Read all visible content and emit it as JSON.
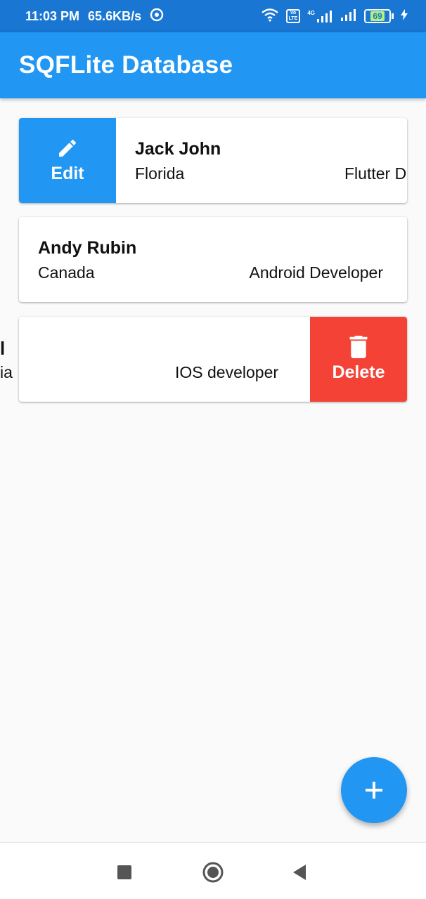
{
  "status_bar": {
    "time": "11:03 PM",
    "speed": "65.6KB/s",
    "network_label_1": "Vo",
    "network_label_2": "LTE",
    "network_type": "4G",
    "battery": "69"
  },
  "app_bar": {
    "title": "SQFLite Database"
  },
  "records": [
    {
      "name": "Jack John",
      "city": "Florida",
      "role": "Flutter Dev",
      "action_label": "Edit"
    },
    {
      "name": "Andy Rubin",
      "city": "Canada",
      "role": "Android Developer"
    },
    {
      "name_fragment": "l",
      "city_fragment": "ia",
      "role": "IOS developer",
      "action_label": "Delete"
    }
  ],
  "colors": {
    "primary": "#2196f3",
    "status_bar": "#1976d2",
    "delete": "#f44336",
    "background": "#fafafa"
  },
  "icons": {
    "edit": "pencil-icon",
    "delete": "trash-icon",
    "fab": "plus-icon",
    "nav_recents": "square-icon",
    "nav_home": "circle-icon",
    "nav_back": "triangle-back-icon"
  }
}
